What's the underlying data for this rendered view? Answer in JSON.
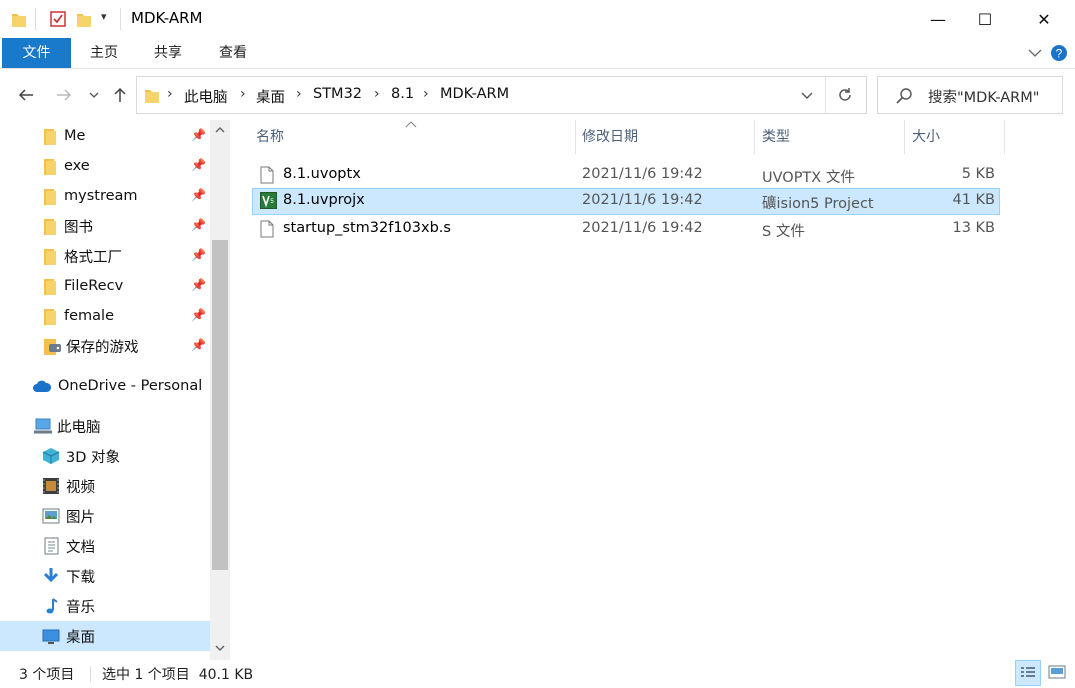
{
  "window": {
    "title": "MDK-ARM",
    "controls": {
      "minimize": "—",
      "maximize": "☐",
      "close": "✕"
    }
  },
  "ribbon": {
    "tabs": [
      "文件",
      "主页",
      "共享",
      "查看"
    ],
    "collapse_icon": "chevron-down-icon",
    "help_icon": "help-icon",
    "accent": "#1979ca"
  },
  "address": {
    "breadcrumb": [
      "此电脑",
      "桌面",
      "STM32",
      "8.1",
      "MDK-ARM"
    ],
    "search_placeholder": "搜索\"MDK-ARM\""
  },
  "navpane": {
    "quick_access": [
      {
        "label": "Me",
        "pinned": true
      },
      {
        "label": "exe",
        "pinned": true
      },
      {
        "label": "mystream",
        "pinned": true
      },
      {
        "label": "图书",
        "pinned": true
      },
      {
        "label": "格式工厂",
        "pinned": true
      },
      {
        "label": "FileRecv",
        "pinned": true
      },
      {
        "label": "female",
        "pinned": true
      },
      {
        "label": "保存的游戏",
        "pinned": true
      }
    ],
    "onedrive": "OneDrive - Personal",
    "this_pc": "此电脑",
    "pc_items": [
      "3D 对象",
      "视频",
      "图片",
      "文档",
      "下载",
      "音乐",
      "桌面"
    ],
    "selected": "桌面"
  },
  "filelist": {
    "columns": [
      "名称",
      "修改日期",
      "类型",
      "大小"
    ],
    "rows": [
      {
        "name": "8.1.uvoptx",
        "date": "2021/11/6 19:42",
        "type": "UVOPTX 文件",
        "size": "5 KB",
        "icon": "file-icon"
      },
      {
        "name": "8.1.uvprojx",
        "date": "2021/11/6 19:42",
        "type": "礦ision5 Project",
        "size": "41 KB",
        "icon": "uvision-project-icon",
        "selected": true
      },
      {
        "name": "startup_stm32f103xb.s",
        "date": "2021/11/6 19:42",
        "type": "S 文件",
        "size": "13 KB",
        "icon": "file-icon"
      }
    ]
  },
  "status": {
    "count": "3 个项目",
    "selection": "选中 1 个项目  40.1 KB"
  }
}
